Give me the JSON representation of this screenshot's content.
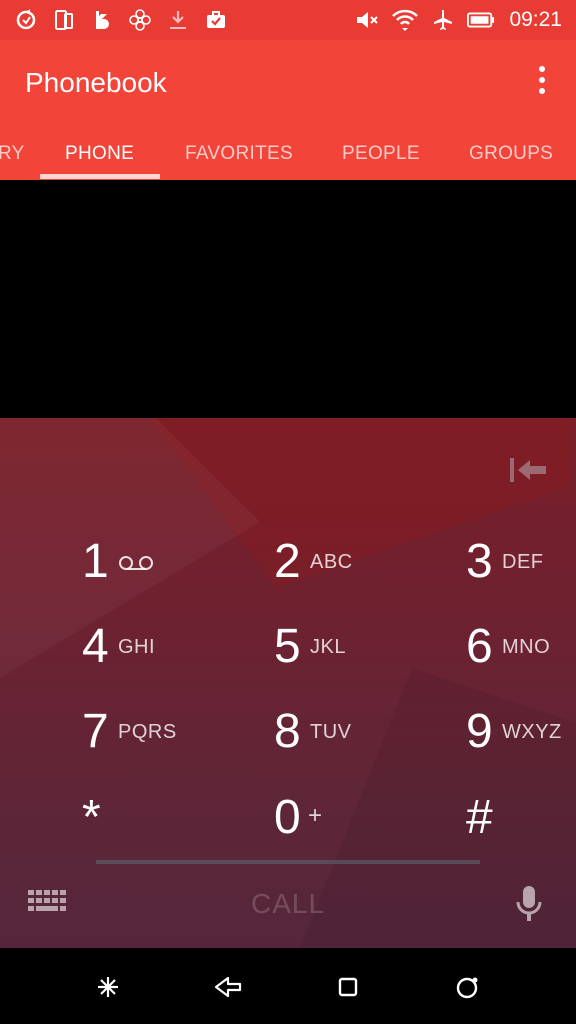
{
  "status_bar": {
    "time": "09:21",
    "icons_left": [
      "sync-icon",
      "tablet-icon",
      "bloomberg-icon",
      "flower-icon",
      "download-icon",
      "briefcase-check-icon"
    ],
    "icons_right": [
      "mute-icon",
      "wifi-icon",
      "airplane-icon",
      "battery-icon"
    ]
  },
  "app_bar": {
    "title": "Phonebook",
    "menu_icon": "more-vert-icon",
    "tabs": [
      {
        "label": "RY",
        "active": false
      },
      {
        "label": "PHONE",
        "active": true
      },
      {
        "label": "FAVORITES",
        "active": false
      },
      {
        "label": "PEOPLE",
        "active": false
      },
      {
        "label": "GROUPS",
        "active": false
      }
    ]
  },
  "dialpad": {
    "keys": [
      {
        "digit": "1",
        "letters": "",
        "icon": "voicemail-icon"
      },
      {
        "digit": "2",
        "letters": "ABC"
      },
      {
        "digit": "3",
        "letters": "DEF"
      },
      {
        "digit": "4",
        "letters": "GHI"
      },
      {
        "digit": "5",
        "letters": "JKL"
      },
      {
        "digit": "6",
        "letters": "MNO"
      },
      {
        "digit": "7",
        "letters": "PQRS"
      },
      {
        "digit": "8",
        "letters": "TUV"
      },
      {
        "digit": "9",
        "letters": "WXYZ"
      },
      {
        "digit": "*",
        "letters": ""
      },
      {
        "digit": "0",
        "letters": "+"
      },
      {
        "digit": "#",
        "letters": ""
      }
    ],
    "call_label": "CALL",
    "colors": {
      "accent": "#f3443a",
      "status_bar": "#e83b33"
    }
  },
  "nav_bar": {
    "icons": [
      "asterisk-icon",
      "back-icon",
      "home-square-icon",
      "recents-circle-icon"
    ]
  }
}
